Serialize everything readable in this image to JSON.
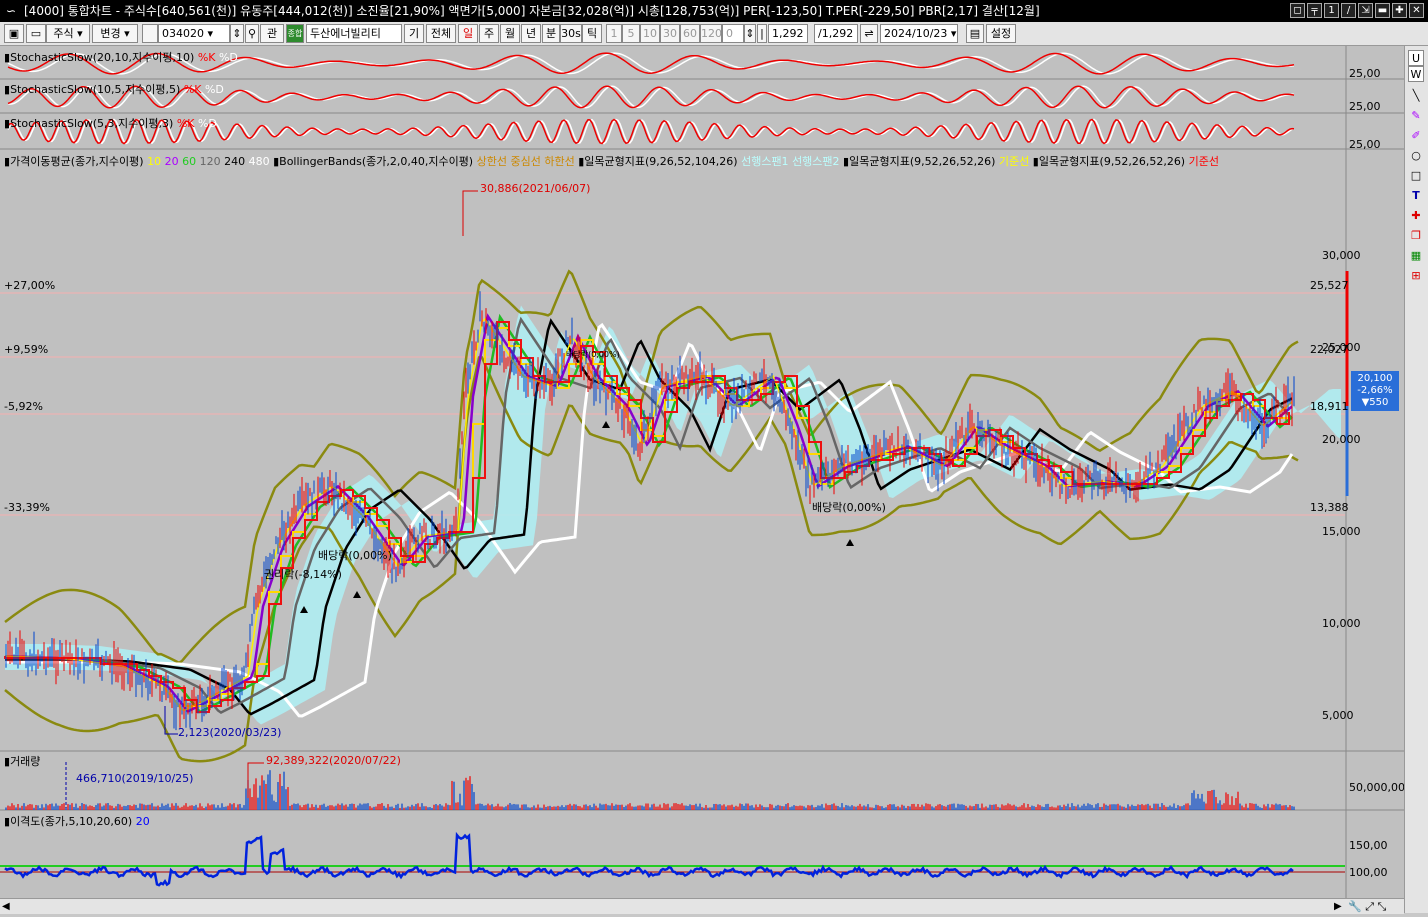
{
  "title": {
    "logo": "∽",
    "text": "[4000] 통합차트 - 주식수[640,561(천)] 유동주[444,012(천)] 소진율[21,90%] 액면가[5,000] 자본금[32,028(억)] 시총[128,753(억)] PER[-123,50] T.PER[-229,50] PBR[2,17] 결산[12월]",
    "buttons": [
      "◻",
      "╤",
      "1",
      "/",
      "⇲",
      "▬",
      "✚",
      "✕"
    ]
  },
  "toolbar": {
    "market": "주식",
    "change": "변경",
    "code": "034020",
    "find": "관",
    "badge": "종합",
    "stock_name": "두산에너빌리티",
    "b_gi": "기",
    "b_all": "전체",
    "periods": [
      "일",
      "주",
      "월",
      "년",
      "분",
      "30s",
      "틱"
    ],
    "minutes": [
      "1",
      "5",
      "10",
      "30",
      "60",
      "120"
    ],
    "spin_value": "0",
    "count1": "1,292",
    "count2": "/1,292",
    "date": "2024/10/23",
    "settings": "설정"
  },
  "colors": {
    "red": "#ff0000",
    "accent": "#2a6ed8",
    "olive": "#808000",
    "white": "#ffffff",
    "chart_bg": "#c0c0c0"
  },
  "panels": {
    "stoch1": {
      "name": "StochasticSlow(20,10,지수이평,10)",
      "k": "%K",
      "d": "%D",
      "level": "25,00"
    },
    "stoch2": {
      "name": "StochasticSlow(10,5,지수이평,5)",
      "k": "%K",
      "d": "%D",
      "level": "25,00"
    },
    "stoch3": {
      "name": "StochasticSlow(5,3,지수이평,3)",
      "k": "%K",
      "d": "%D",
      "level": "25,00"
    },
    "legend": {
      "ma": "가격이동평균(종가,지수이평)",
      "ma_periods": [
        "10",
        "20",
        "60",
        "120",
        "240",
        "480"
      ],
      "bb": "BollingerBands(종가,2,0,40,지수이평)",
      "bb_lines": [
        "상한선",
        "중심선",
        "하한선"
      ],
      "ichi1": "일목균형지표(9,26,52,104,26)",
      "ichi1_lines": [
        "선행스팬1",
        "선행스팬2"
      ],
      "ichi2": "일목균형지표(9,52,26,52,26)",
      "ichi2_line": "기준선",
      "ichi3": "일목균형지표(9,52,26,52,26)",
      "ichi3_line": "기준선"
    },
    "price_axis": [
      "30,000",
      "25,000",
      "20,000",
      "15,000",
      "10,000",
      "5,000"
    ],
    "pct_lines": [
      "+27,00%",
      "+9,59%",
      "-5,92%",
      "-33,39%"
    ],
    "pct_values": [
      "25,527",
      "22,027",
      "18,911",
      "13,388"
    ],
    "annotations": {
      "high": "30,886(2021/06/07)",
      "low": "2,123(2020/03/23)",
      "div1": "배당락(0,00%)",
      "rights": "권리락(-8,14%)",
      "div2": "배당락(0,00%)",
      "div3": "배당락(0,00%)"
    },
    "current": {
      "price": "20,100",
      "pct": "-2,66%",
      "change": "▼550"
    },
    "volume": {
      "name": "거래량",
      "max": "92,389,322(2020/07/22)",
      "min": "466,710(2019/10/25)",
      "axis": "50,000,000"
    },
    "disparity": {
      "name": "이격도(종가,5,10,20,60)",
      "period": "20",
      "axis_hi": "150,00",
      "axis_lo": "100,00"
    }
  },
  "right_tools": {
    "top1": "U",
    "top2": "W"
  }
}
